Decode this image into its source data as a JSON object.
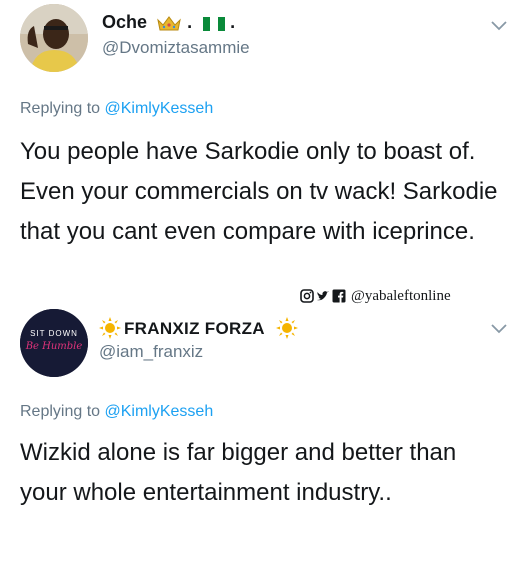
{
  "tweets": [
    {
      "display_name": "Oche",
      "name_suffix": ".",
      "name_suffix_end": ".",
      "handle": "@Dvomiztasammie",
      "replying_prefix": "Replying to",
      "replying_mention": "@KimlyKesseh",
      "body": "You people have Sarkodie only to boast of.  Even your commercials on tv wack!  Sarkodie that you cant even compare with iceprince."
    },
    {
      "display_name": "FRANXIZ FORZA",
      "handle": "@iam_franxiz",
      "avatar_text_top": "SIT DOWN",
      "avatar_text_bottom": "Be Humble",
      "replying_prefix": "Replying to",
      "replying_mention": "@KimlyKesseh",
      "body": "Wizkid alone is far bigger and better than your whole entertainment industry.."
    }
  ],
  "watermark": {
    "text": "@yabaleftonline",
    "icons": [
      "instagram-icon",
      "twitter-icon",
      "facebook-icon"
    ]
  },
  "colors": {
    "link": "#1da1f2",
    "secondary_text": "#657786",
    "primary_text": "#14171a"
  }
}
